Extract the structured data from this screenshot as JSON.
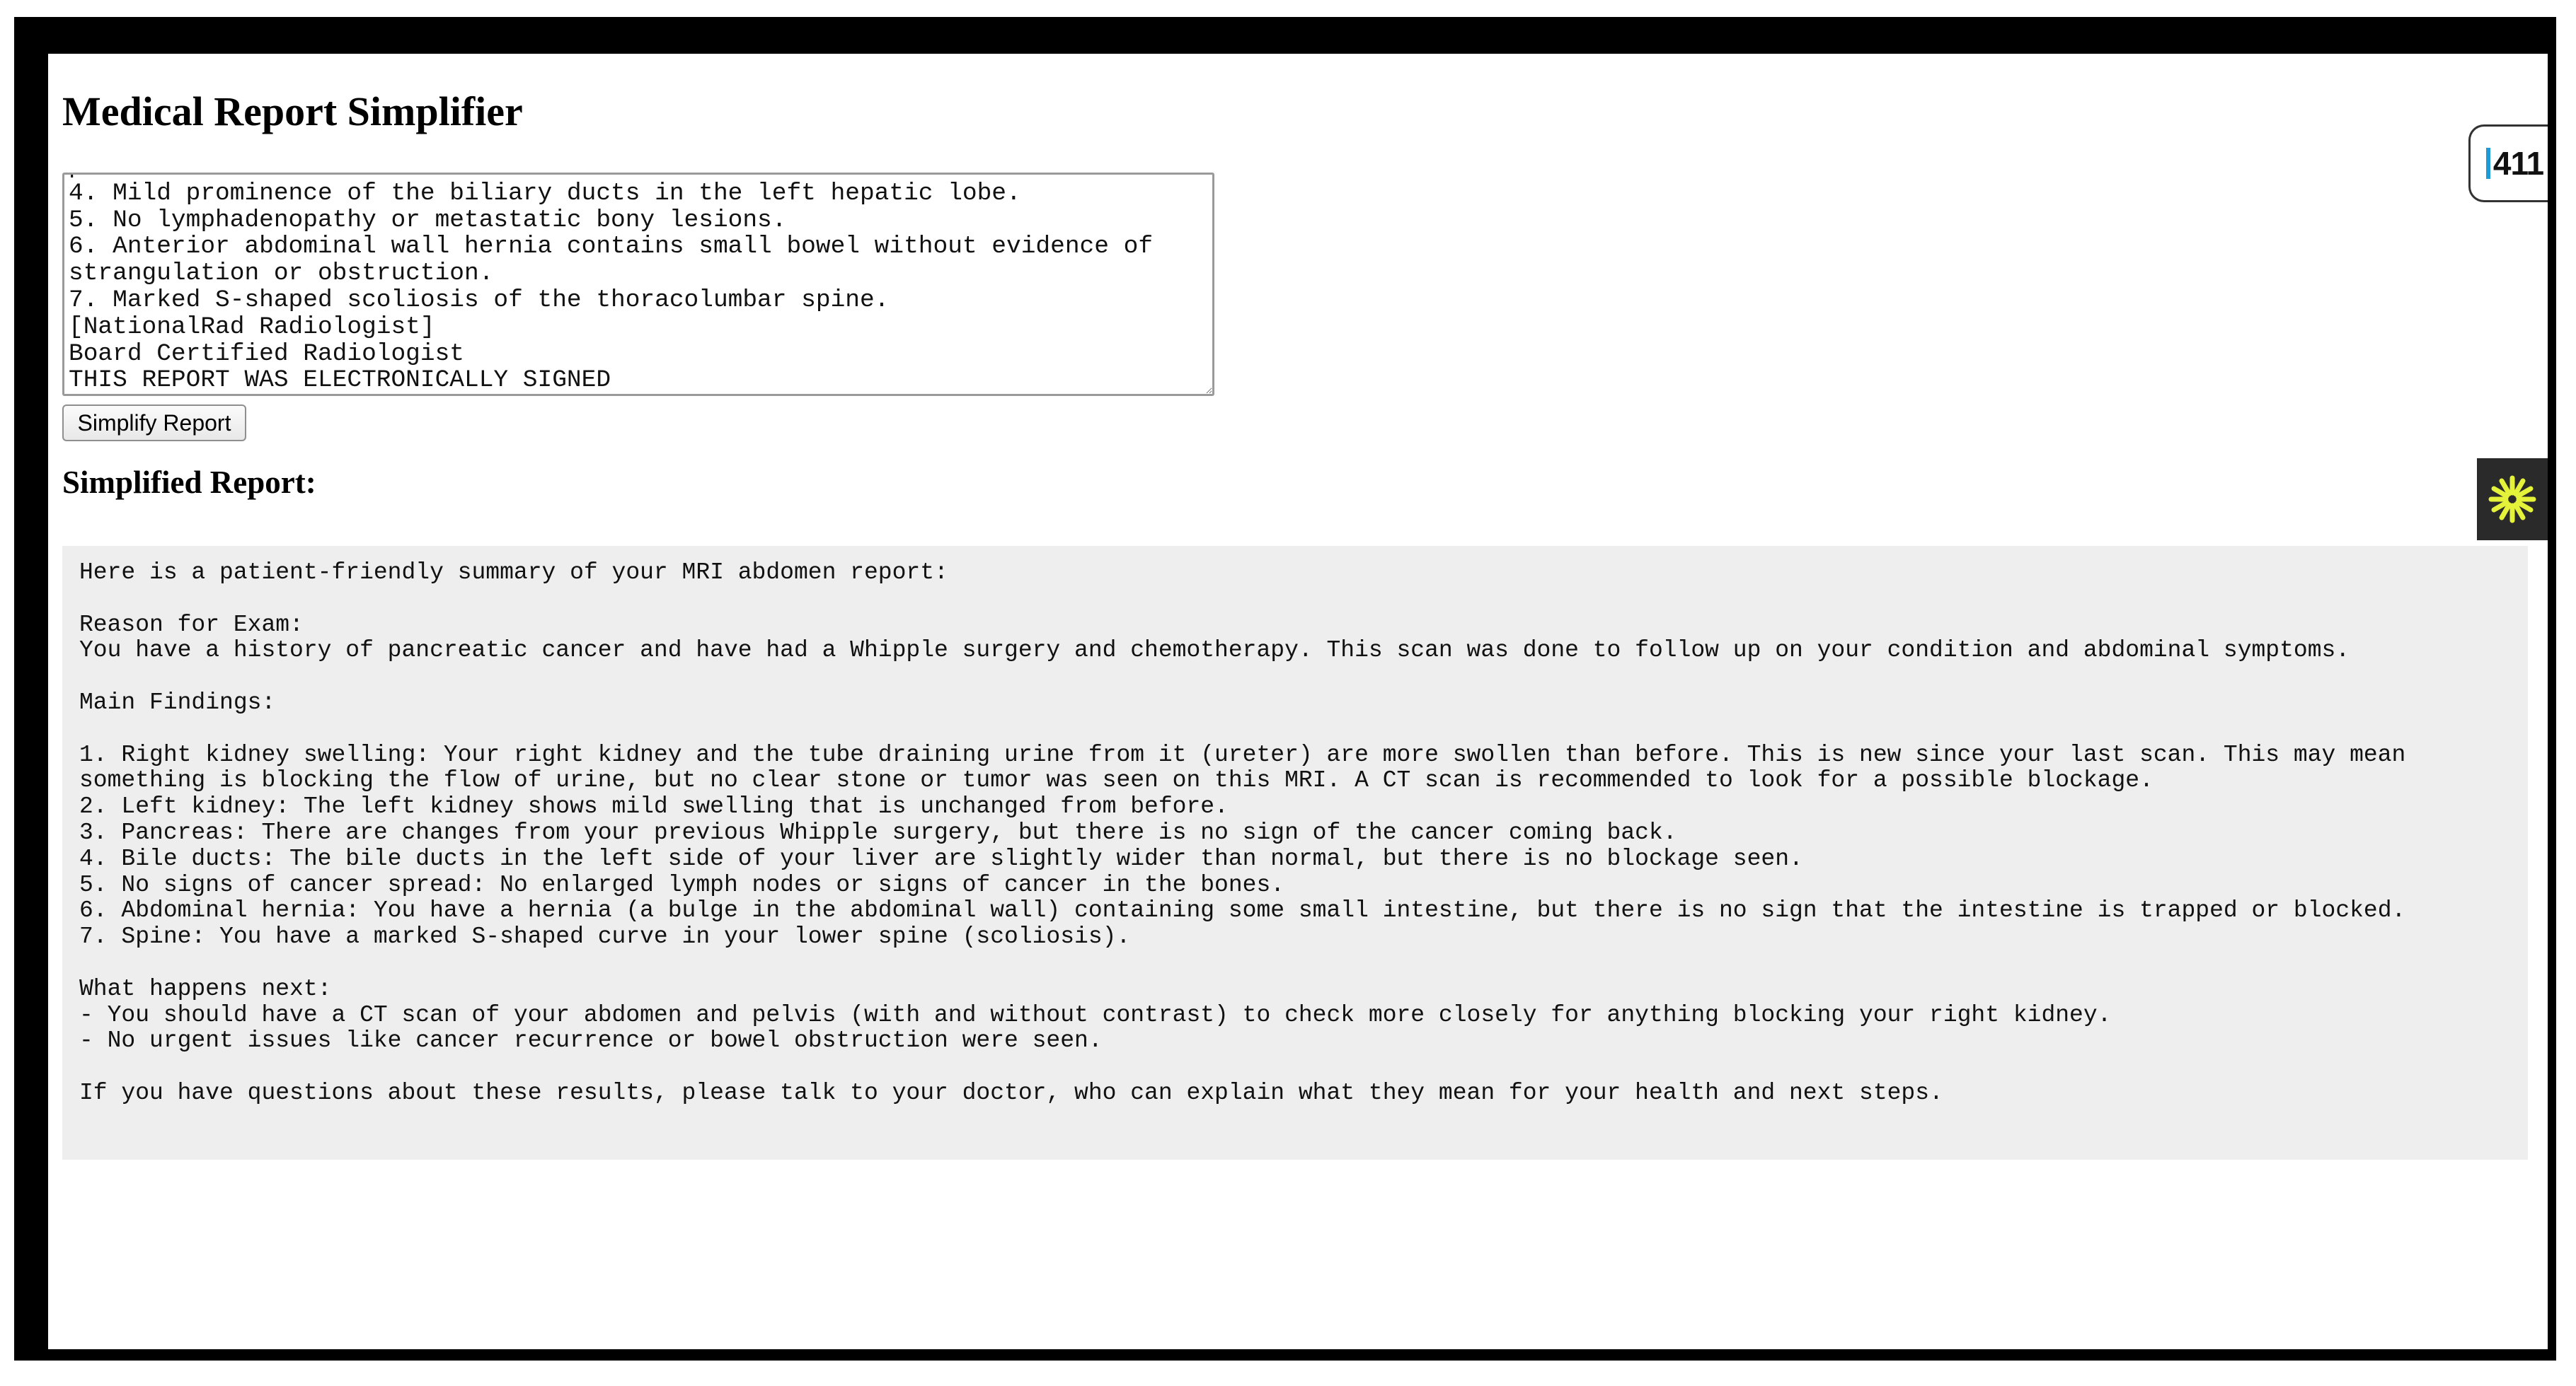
{
  "app": {
    "title": "Medical Report Simplifier"
  },
  "input": {
    "report_text": "pancreas or anastomosis.\n4. Mild prominence of the biliary ducts in the left hepatic lobe.\n5. No lymphadenopathy or metastatic bony lesions.\n6. Anterior abdominal wall hernia contains small bowel without evidence of\nstrangulation or obstruction.\n7. Marked S-shaped scoliosis of the thoracolumbar spine.\n[NationalRad Radiologist]\nBoard Certified Radiologist\nTHIS REPORT WAS ELECTRONICALLY SIGNED"
  },
  "actions": {
    "simplify_label": "Simplify Report"
  },
  "output": {
    "heading": "Simplified Report:",
    "text": "Here is a patient-friendly summary of your MRI abdomen report:\n\nReason for Exam:\nYou have a history of pancreatic cancer and have had a Whipple surgery and chemotherapy. This scan was done to follow up on your condition and abdominal symptoms.\n\nMain Findings:\n\n1. Right kidney swelling: Your right kidney and the tube draining urine from it (ureter) are more swollen than before. This is new since your last scan. This may mean something is blocking the flow of urine, but no clear stone or tumor was seen on this MRI. A CT scan is recommended to look for a possible blockage.\n2. Left kidney: The left kidney shows mild swelling that is unchanged from before.\n3. Pancreas: There are changes from your previous Whipple surgery, but there is no sign of the cancer coming back.\n4. Bile ducts: The bile ducts in the left side of your liver are slightly wider than normal, but there is no blockage seen.\n5. No signs of cancer spread: No enlarged lymph nodes or signs of cancer in the bones.\n6. Abdominal hernia: You have a hernia (a bulge in the abdominal wall) containing some small intestine, but there is no sign that the intestine is trapped or blocked.\n7. Spine: You have a marked S-shaped curve in your lower spine (scoliosis).\n\nWhat happens next:\n- You should have a CT scan of your abdomen and pelvis (with and without contrast) to check more closely for anything blocking your right kidney.\n- No urgent issues like cancer recurrence or bowel obstruction were seen.\n\nIf you have questions about these results, please talk to your doctor, who can explain what they mean for your health and next steps."
  },
  "widgets": {
    "badge_text": "411",
    "badge_icon": "411-badge-icon",
    "side_widget_icon": "asterisk-icon",
    "side_widget_color": "#e5f23a",
    "badge_accent_color": "#1e9bd7"
  }
}
